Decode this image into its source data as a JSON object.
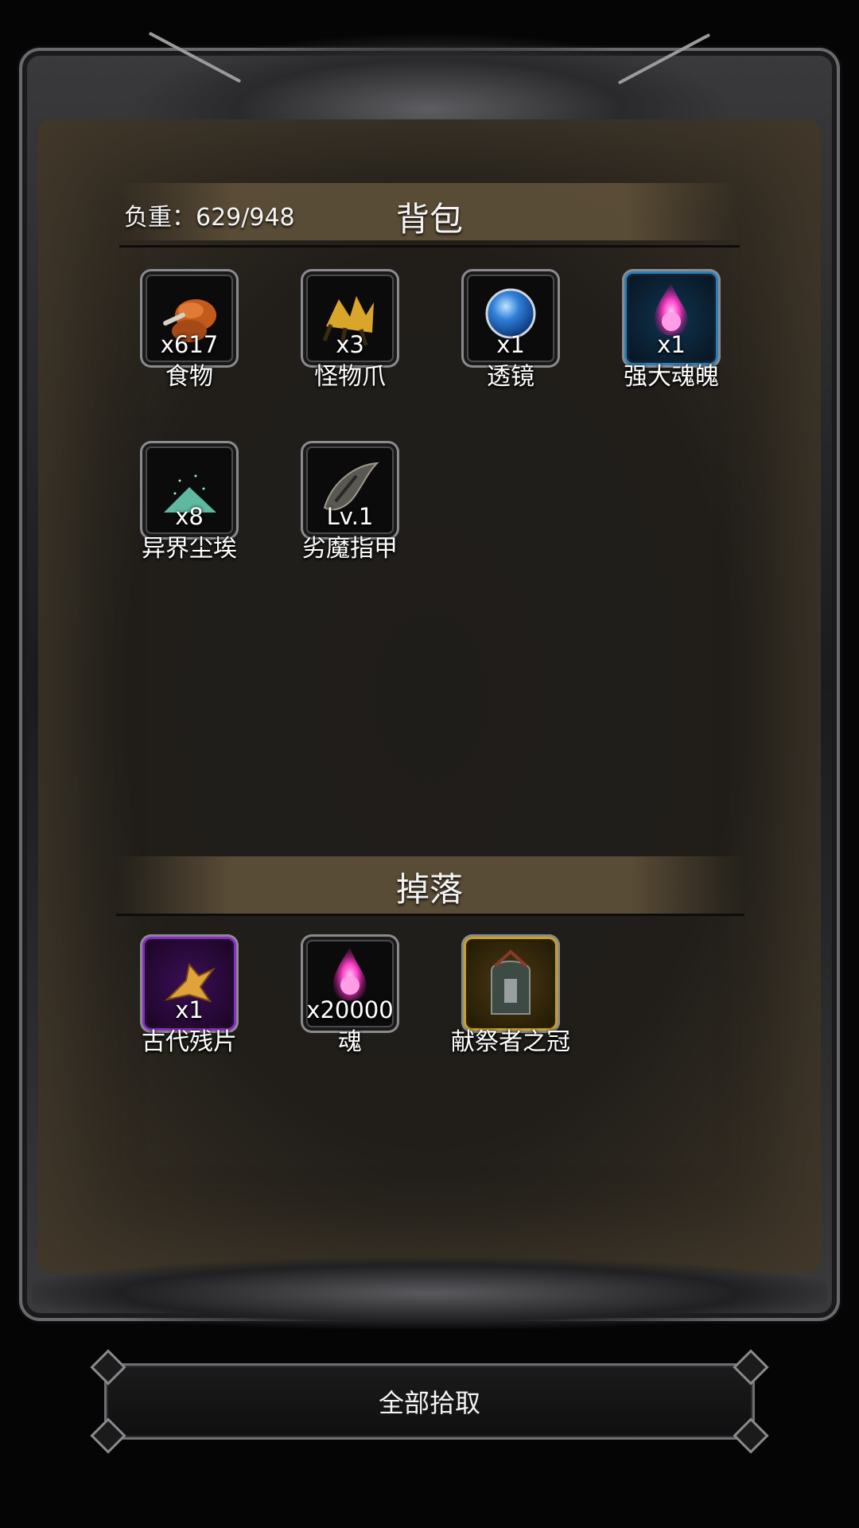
{
  "backpack": {
    "title": "背包",
    "weight_label": "负重：629/948",
    "items": [
      {
        "name": "食物",
        "count": "x617",
        "icon": "food-icon"
      },
      {
        "name": "怪物爪",
        "count": "x3",
        "icon": "monster-claw-icon"
      },
      {
        "name": "透镜",
        "count": "x1",
        "icon": "lens-icon"
      },
      {
        "name": "强大魂魄",
        "count": "x1",
        "icon": "powerful-soul-icon"
      },
      {
        "name": "异界尘埃",
        "count": "x8",
        "icon": "otherworld-dust-icon"
      },
      {
        "name": "劣魔指甲",
        "count": "Lv.1",
        "icon": "imp-nail-icon"
      }
    ]
  },
  "drops": {
    "title": "掉落",
    "items": [
      {
        "name": "古代残片",
        "count": "x1",
        "icon": "ancient-fragment-icon"
      },
      {
        "name": "魂",
        "count": "x20000",
        "icon": "soul-icon"
      },
      {
        "name": "献祭者之冠",
        "count": "",
        "icon": "sacrificer-crown-icon"
      }
    ]
  },
  "actions": {
    "pickup_all_label": "全部拾取"
  },
  "colors": {
    "panel_bg": "#211e1a",
    "bar_brown": "#5c4e37",
    "rare_blue": "#2b7fb8",
    "epic_purple": "#8a2ac8",
    "legend_gold": "#c8a028"
  }
}
